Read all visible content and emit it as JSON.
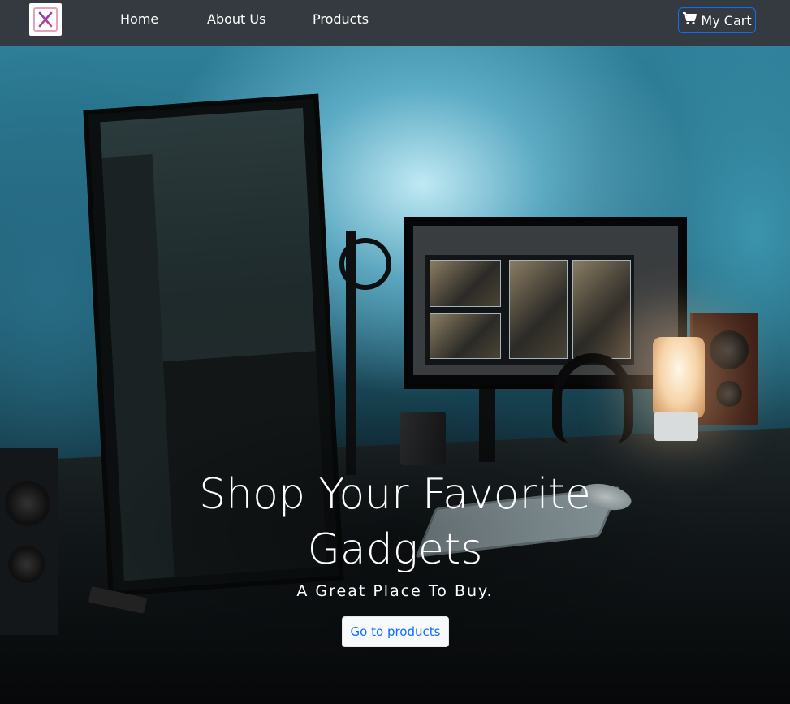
{
  "navbar": {
    "logo_icon": "brand-x-logo-icon",
    "links": [
      {
        "label": "Home"
      },
      {
        "label": "About Us"
      },
      {
        "label": "Products"
      }
    ],
    "cart": {
      "icon": "shopping-cart-icon",
      "label": "My Cart",
      "border_color": "#0d6efd"
    },
    "background_color": "#343a40"
  },
  "hero": {
    "title": "Shop Your Favorite Gadgets",
    "subtitle": "A Great Place To Buy.",
    "cta_label": "Go to products",
    "cta_text_color": "#0d6efd"
  }
}
